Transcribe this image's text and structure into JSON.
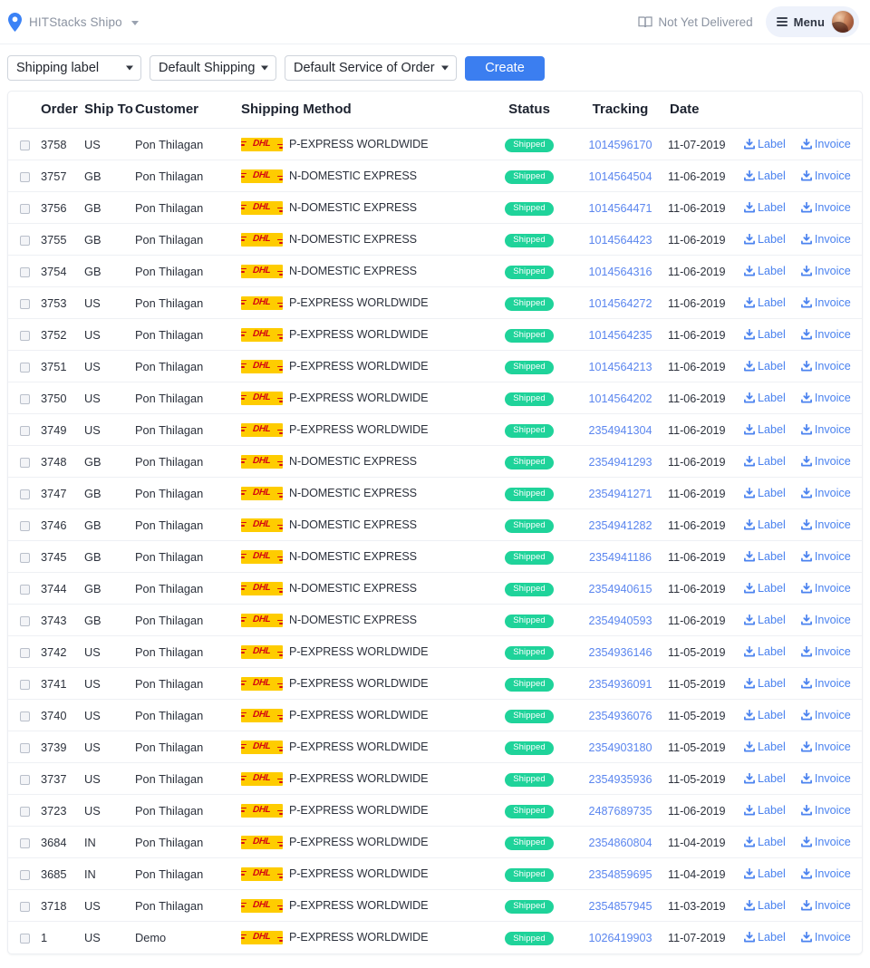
{
  "topbar": {
    "brand_label": "HITStacks Shipo",
    "brand_icon": "location-pin-icon",
    "brand_caret": "chevron-down-icon",
    "not_yet_delivered": "Not Yet Delivered",
    "not_yet_delivered_icon": "open-book-icon",
    "menu_label": "Menu",
    "menu_icon": "hamburger-icon",
    "avatar": "user-avatar"
  },
  "toolbar": {
    "label_type": "Shipping label",
    "shipping": "Default Shipping",
    "service": "Default Service of Order",
    "create_label": "Create"
  },
  "colors": {
    "accent_blue": "#3b7ef0",
    "link_blue": "#5b86ef",
    "status_green": "#1fd39a",
    "dhl_yellow": "#fecc00",
    "dhl_red": "#d40511"
  },
  "table": {
    "columns": [
      "",
      "Order",
      "Ship To",
      "Customer",
      "Shipping Method",
      "Status",
      "Tracking",
      "Date",
      ""
    ],
    "action_label_label": "Label",
    "action_invoice_label": "Invoice",
    "rows": [
      {
        "order": "3758",
        "ship_to": "US",
        "customer": "Pon Thilagan",
        "carrier": "DHL",
        "method": "P-EXPRESS WORLDWIDE",
        "status": "Shipped",
        "tracking": "1014596170",
        "date": "11-07-2019"
      },
      {
        "order": "3757",
        "ship_to": "GB",
        "customer": "Pon Thilagan",
        "carrier": "DHL",
        "method": "N-DOMESTIC EXPRESS",
        "status": "Shipped",
        "tracking": "1014564504",
        "date": "11-06-2019"
      },
      {
        "order": "3756",
        "ship_to": "GB",
        "customer": "Pon Thilagan",
        "carrier": "DHL",
        "method": "N-DOMESTIC EXPRESS",
        "status": "Shipped",
        "tracking": "1014564471",
        "date": "11-06-2019"
      },
      {
        "order": "3755",
        "ship_to": "GB",
        "customer": "Pon Thilagan",
        "carrier": "DHL",
        "method": "N-DOMESTIC EXPRESS",
        "status": "Shipped",
        "tracking": "1014564423",
        "date": "11-06-2019"
      },
      {
        "order": "3754",
        "ship_to": "GB",
        "customer": "Pon Thilagan",
        "carrier": "DHL",
        "method": "N-DOMESTIC EXPRESS",
        "status": "Shipped",
        "tracking": "1014564316",
        "date": "11-06-2019"
      },
      {
        "order": "3753",
        "ship_to": "US",
        "customer": "Pon Thilagan",
        "carrier": "DHL",
        "method": "P-EXPRESS WORLDWIDE",
        "status": "Shipped",
        "tracking": "1014564272",
        "date": "11-06-2019"
      },
      {
        "order": "3752",
        "ship_to": "US",
        "customer": "Pon Thilagan",
        "carrier": "DHL",
        "method": "P-EXPRESS WORLDWIDE",
        "status": "Shipped",
        "tracking": "1014564235",
        "date": "11-06-2019"
      },
      {
        "order": "3751",
        "ship_to": "US",
        "customer": "Pon Thilagan",
        "carrier": "DHL",
        "method": "P-EXPRESS WORLDWIDE",
        "status": "Shipped",
        "tracking": "1014564213",
        "date": "11-06-2019"
      },
      {
        "order": "3750",
        "ship_to": "US",
        "customer": "Pon Thilagan",
        "carrier": "DHL",
        "method": "P-EXPRESS WORLDWIDE",
        "status": "Shipped",
        "tracking": "1014564202",
        "date": "11-06-2019"
      },
      {
        "order": "3749",
        "ship_to": "US",
        "customer": "Pon Thilagan",
        "carrier": "DHL",
        "method": "P-EXPRESS WORLDWIDE",
        "status": "Shipped",
        "tracking": "2354941304",
        "date": "11-06-2019"
      },
      {
        "order": "3748",
        "ship_to": "GB",
        "customer": "Pon Thilagan",
        "carrier": "DHL",
        "method": "N-DOMESTIC EXPRESS",
        "status": "Shipped",
        "tracking": "2354941293",
        "date": "11-06-2019"
      },
      {
        "order": "3747",
        "ship_to": "GB",
        "customer": "Pon Thilagan",
        "carrier": "DHL",
        "method": "N-DOMESTIC EXPRESS",
        "status": "Shipped",
        "tracking": "2354941271",
        "date": "11-06-2019"
      },
      {
        "order": "3746",
        "ship_to": "GB",
        "customer": "Pon Thilagan",
        "carrier": "DHL",
        "method": "N-DOMESTIC EXPRESS",
        "status": "Shipped",
        "tracking": "2354941282",
        "date": "11-06-2019"
      },
      {
        "order": "3745",
        "ship_to": "GB",
        "customer": "Pon Thilagan",
        "carrier": "DHL",
        "method": "N-DOMESTIC EXPRESS",
        "status": "Shipped",
        "tracking": "2354941186",
        "date": "11-06-2019"
      },
      {
        "order": "3744",
        "ship_to": "GB",
        "customer": "Pon Thilagan",
        "carrier": "DHL",
        "method": "N-DOMESTIC EXPRESS",
        "status": "Shipped",
        "tracking": "2354940615",
        "date": "11-06-2019"
      },
      {
        "order": "3743",
        "ship_to": "GB",
        "customer": "Pon Thilagan",
        "carrier": "DHL",
        "method": "N-DOMESTIC EXPRESS",
        "status": "Shipped",
        "tracking": "2354940593",
        "date": "11-06-2019"
      },
      {
        "order": "3742",
        "ship_to": "US",
        "customer": "Pon Thilagan",
        "carrier": "DHL",
        "method": "P-EXPRESS WORLDWIDE",
        "status": "Shipped",
        "tracking": "2354936146",
        "date": "11-05-2019"
      },
      {
        "order": "3741",
        "ship_to": "US",
        "customer": "Pon Thilagan",
        "carrier": "DHL",
        "method": "P-EXPRESS WORLDWIDE",
        "status": "Shipped",
        "tracking": "2354936091",
        "date": "11-05-2019"
      },
      {
        "order": "3740",
        "ship_to": "US",
        "customer": "Pon Thilagan",
        "carrier": "DHL",
        "method": "P-EXPRESS WORLDWIDE",
        "status": "Shipped",
        "tracking": "2354936076",
        "date": "11-05-2019"
      },
      {
        "order": "3739",
        "ship_to": "US",
        "customer": "Pon Thilagan",
        "carrier": "DHL",
        "method": "P-EXPRESS WORLDWIDE",
        "status": "Shipped",
        "tracking": "2354903180",
        "date": "11-05-2019"
      },
      {
        "order": "3737",
        "ship_to": "US",
        "customer": "Pon Thilagan",
        "carrier": "DHL",
        "method": "P-EXPRESS WORLDWIDE",
        "status": "Shipped",
        "tracking": "2354935936",
        "date": "11-05-2019"
      },
      {
        "order": "3723",
        "ship_to": "US",
        "customer": "Pon Thilagan",
        "carrier": "DHL",
        "method": "P-EXPRESS WORLDWIDE",
        "status": "Shipped",
        "tracking": "2487689735",
        "date": "11-06-2019"
      },
      {
        "order": "3684",
        "ship_to": "IN",
        "customer": "Pon Thilagan",
        "carrier": "DHL",
        "method": "P-EXPRESS WORLDWIDE",
        "status": "Shipped",
        "tracking": "2354860804",
        "date": "11-04-2019"
      },
      {
        "order": "3685",
        "ship_to": "IN",
        "customer": "Pon Thilagan",
        "carrier": "DHL",
        "method": "P-EXPRESS WORLDWIDE",
        "status": "Shipped",
        "tracking": "2354859695",
        "date": "11-04-2019"
      },
      {
        "order": "3718",
        "ship_to": "US",
        "customer": "Pon Thilagan",
        "carrier": "DHL",
        "method": "P-EXPRESS WORLDWIDE",
        "status": "Shipped",
        "tracking": "2354857945",
        "date": "11-03-2019"
      },
      {
        "order": "1",
        "ship_to": "US",
        "customer": "Demo",
        "carrier": "DHL",
        "method": "P-EXPRESS WORLDWIDE",
        "status": "Shipped",
        "tracking": "1026419903",
        "date": "11-07-2019"
      }
    ]
  }
}
